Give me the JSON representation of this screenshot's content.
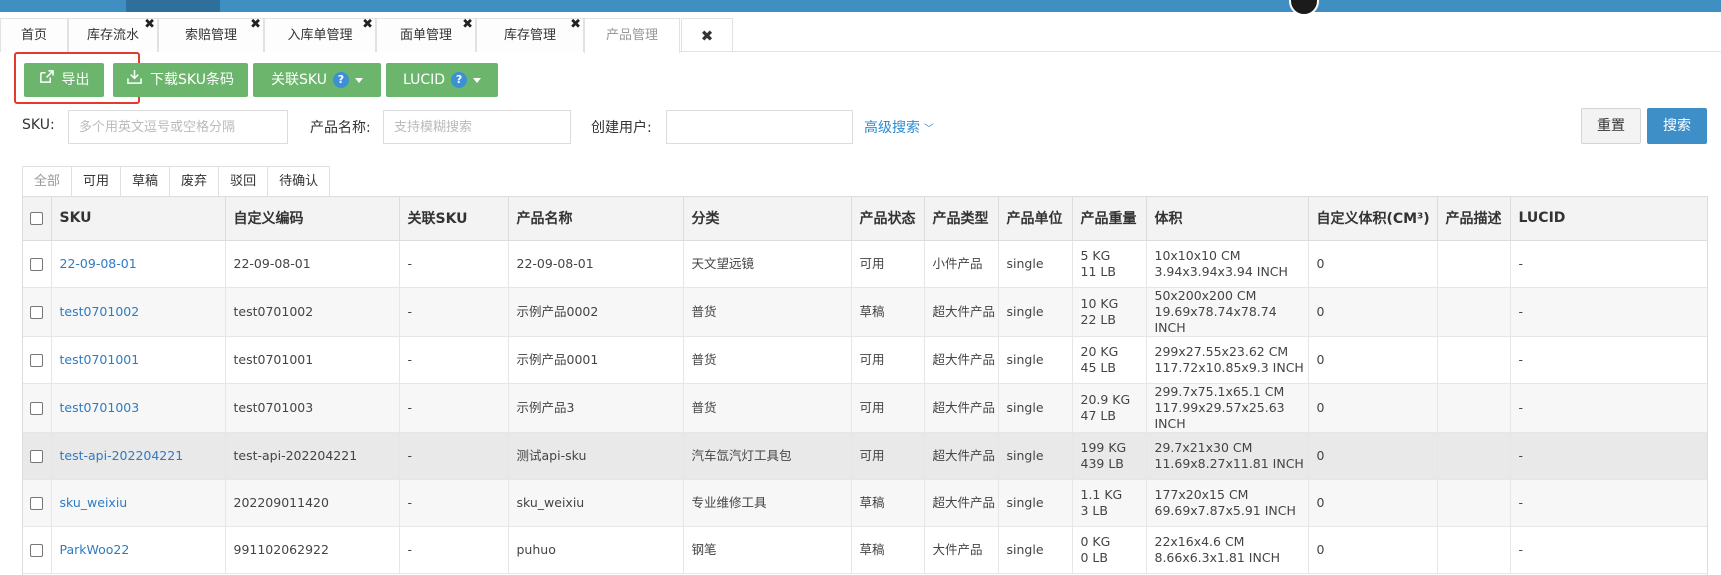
{
  "tabs": [
    {
      "label": "首页",
      "closable": false
    },
    {
      "label": "库存流水",
      "closable": true
    },
    {
      "label": "索赔管理",
      "closable": true
    },
    {
      "label": "入库单管理",
      "closable": true
    },
    {
      "label": "面单管理",
      "closable": true
    },
    {
      "label": "库存管理",
      "closable": true
    },
    {
      "label": "产品管理",
      "closable": false,
      "active": true
    }
  ],
  "tab_close_glyph": "✖",
  "actions": {
    "export": "导出",
    "download_sku": "下载SKU条码",
    "link_sku": "关联SKU",
    "lucid": "LUCID"
  },
  "filters": {
    "sku_label": "SKU:",
    "sku_placeholder": "多个用英文逗号或空格分隔",
    "name_label": "产品名称:",
    "name_placeholder": "支持模糊搜索",
    "user_label": "创建用户:",
    "user_placeholder": "",
    "advanced": "高级搜索",
    "reset": "重置",
    "search": "搜索"
  },
  "status_tabs": [
    "全部",
    "可用",
    "草稿",
    "废弃",
    "驳回",
    "待确认"
  ],
  "columns": [
    "SKU",
    "自定义编码",
    "关联SKU",
    "产品名称",
    "分类",
    "产品状态",
    "产品类型",
    "产品单位",
    "产品重量",
    "体积",
    "自定义体积(CM³)",
    "产品描述",
    "LUCID"
  ],
  "rows": [
    {
      "sku": "22-09-08-01",
      "code": "22-09-08-01",
      "link": "-",
      "name": "22-09-08-01",
      "category": "天文望远镜",
      "status": "可用",
      "type": "小件产品",
      "unit": "single",
      "weight_kg": "5 KG",
      "weight_lb": "11 LB",
      "vol_cm": "10x10x10 CM",
      "vol_in": "3.94x3.94x3.94 INCH",
      "custom_vol": "0",
      "desc": "",
      "lucid": "-"
    },
    {
      "sku": "test0701002",
      "code": "test0701002",
      "link": "-",
      "name": "示例产品0002",
      "category": "普货",
      "status": "草稿",
      "type": "超大件产品",
      "unit": "single",
      "weight_kg": "10 KG",
      "weight_lb": "22 LB",
      "vol_cm": "50x200x200 CM",
      "vol_in": "19.69x78.74x78.74 INCH",
      "custom_vol": "0",
      "desc": "",
      "lucid": "-"
    },
    {
      "sku": "test0701001",
      "code": "test0701001",
      "link": "-",
      "name": "示例产品0001",
      "category": "普货",
      "status": "可用",
      "type": "超大件产品",
      "unit": "single",
      "weight_kg": "20 KG",
      "weight_lb": "45 LB",
      "vol_cm": "299x27.55x23.62 CM",
      "vol_in": "117.72x10.85x9.3 INCH",
      "custom_vol": "0",
      "desc": "",
      "lucid": "-"
    },
    {
      "sku": "test0701003",
      "code": "test0701003",
      "link": "-",
      "name": "示例产品3",
      "category": "普货",
      "status": "可用",
      "type": "超大件产品",
      "unit": "single",
      "weight_kg": "20.9 KG",
      "weight_lb": "47 LB",
      "vol_cm": "299.7x75.1x65.1 CM",
      "vol_in": "117.99x29.57x25.63 INCH",
      "custom_vol": "0",
      "desc": "",
      "lucid": "-"
    },
    {
      "sku": "test-api-202204221",
      "code": "test-api-202204221",
      "link": "-",
      "name": "测试api-sku",
      "category": "汽车氙汽灯工具包",
      "status": "可用",
      "type": "超大件产品",
      "unit": "single",
      "weight_kg": "199 KG",
      "weight_lb": "439 LB",
      "vol_cm": "29.7x21x30 CM",
      "vol_in": "11.69x8.27x11.81 INCH",
      "custom_vol": "0",
      "desc": "",
      "lucid": "-"
    },
    {
      "sku": "sku_weixiu",
      "code": "202209011420",
      "link": "-",
      "name": "sku_weixiu",
      "category": "专业维修工具",
      "status": "草稿",
      "type": "超大件产品",
      "unit": "single",
      "weight_kg": "1.1 KG",
      "weight_lb": "3 LB",
      "vol_cm": "177x20x15 CM",
      "vol_in": "69.69x7.87x5.91 INCH",
      "custom_vol": "0",
      "desc": "",
      "lucid": "-"
    },
    {
      "sku": "ParkWoo22",
      "code": "991102062922",
      "link": "-",
      "name": "puhuo",
      "category": "钢笔",
      "status": "草稿",
      "type": "大件产品",
      "unit": "single",
      "weight_kg": "0 KG",
      "weight_lb": "0 LB",
      "vol_cm": "22x16x4.6 CM",
      "vol_in": "8.66x6.3x1.81 INCH",
      "custom_vol": "0",
      "desc": "",
      "lucid": "-"
    }
  ],
  "colors": {
    "green_button": "#6cb56c",
    "primary_blue": "#3e8fc8",
    "link_blue": "#2d7bc4",
    "highlight_red": "#e33a2d"
  }
}
